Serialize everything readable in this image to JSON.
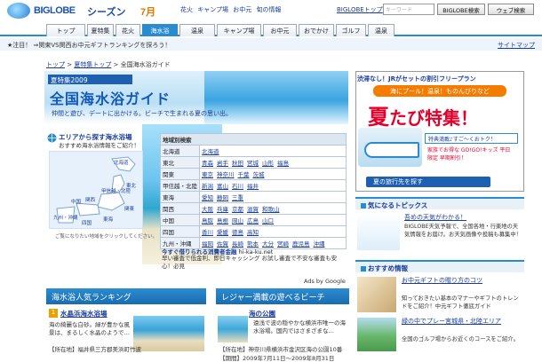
{
  "header": {
    "logo": "BIGLOBE",
    "season": "シーズン",
    "month": "7月",
    "links": [
      "花火",
      "キャンプ場",
      "お中元",
      "旬の情報"
    ],
    "biglobe_top": "BIGLOBEトップ",
    "search_placeholder": "キーワード",
    "search_button": "BIGLOBE検索",
    "web_search_button": "ウェブ検索"
  },
  "tabs": [
    "トップ",
    "夏特集",
    "花火",
    "海水浴",
    "温泉",
    "キャンプ場",
    "お中元",
    "おでかけ",
    "ゴルフ",
    "温泉"
  ],
  "news": {
    "text": "★注目！ ⇒関東VS関西お中元ギフトランキングを探ろう！",
    "sitemap": "サイトマップ"
  },
  "breadcrumb": [
    "トップ",
    "夏特集トップ",
    "全国海水浴ガイド"
  ],
  "hero": {
    "label": "夏特集2009",
    "title": "全国海水浴ガイド",
    "subtitle": "仲間と遊び、デートに出かける。ビーチで生まれる夏の思い出。"
  },
  "area": {
    "title": "エリアから探す海水浴場",
    "sub": "おすすめ海水浴情報をご紹介！",
    "regions": [
      "北海道",
      "東北",
      "関東",
      "甲信越・北陸",
      "東海",
      "関西",
      "中国",
      "四国",
      "九州・沖縄"
    ],
    "note": "ご覧になりたい地域をクリックしてください。"
  },
  "region_table": {
    "header": "地域別検索",
    "rows": [
      {
        "region": "北海道",
        "prefs": [
          "北海道"
        ]
      },
      {
        "region": "東北",
        "prefs": [
          "青森",
          "岩手",
          "秋田",
          "宮城",
          "山形",
          "福島"
        ]
      },
      {
        "region": "関東",
        "prefs": [
          "東京",
          "神奈川",
          "千葉",
          "茨城"
        ]
      },
      {
        "region": "甲信越・北陸",
        "prefs": [
          "新潟",
          "富山",
          "石川",
          "福井"
        ]
      },
      {
        "region": "東海",
        "prefs": [
          "愛知",
          "静岡",
          "三重"
        ]
      },
      {
        "region": "関西",
        "prefs": [
          "大阪",
          "兵庫",
          "京都",
          "滋賀",
          "和歌山"
        ]
      },
      {
        "region": "中国",
        "prefs": [
          "鳥取",
          "島根",
          "岡山",
          "広島",
          "山口"
        ]
      },
      {
        "region": "四国",
        "prefs": [
          "香川",
          "愛媛",
          "徳島",
          "高知"
        ]
      },
      {
        "region": "九州・沖縄",
        "prefs": [
          "福岡",
          "佐賀",
          "長崎",
          "熊本",
          "大分",
          "宮崎",
          "鹿児島",
          "沖縄"
        ]
      }
    ]
  },
  "ad": {
    "title": "今すぐ借りられる消費者金融",
    "url": "hi-ka-ku.net",
    "desc": "早い審査で低金利、即日キャッシング お試し審査で不安な審査も安心！必見",
    "ads_by": "Ads by Google"
  },
  "ranking": {
    "header": "海水浴人気ランキング",
    "num": "1",
    "name": "水晶浜海水浴場",
    "desc": "海の綺麗な白砂。緑が豊かな風景は、まるしく水晶のようで…",
    "loc": "【所在地】福井県三方郡美浜町竹波"
  },
  "leisure": {
    "header": "レジャー満載の遊べるビーチ",
    "name": "海の公園",
    "desc": "遠浅で波の穏やかな横浜市唯一の海水浴場。国内ではさまざまな…",
    "loc": "【所在地】神奈川県横浜市金沢区海の公園10番 【期間】2009年7月11日〜2009年8月31日"
  },
  "jr": {
    "top": "渋滞なし！JRがセットの割引フリープラン",
    "pill": "海にプール！温泉！ものんびりなど",
    "big": "夏",
    "big_rest": "たび特集！",
    "promo1": "特典満載♪すご〜くおトク！",
    "promo2": "家族でお得な GO!GO!キッズ 平日限定 早期割引！",
    "button": "夏の旅行先を探す"
  },
  "topics": {
    "header": "気になるトピックス",
    "link": "吾めの天気がわかる！",
    "desc": "BIGLOBE天気予報で、全国各地・行楽地の天気情報をお届け。お天気画像や投稿も募集中！"
  },
  "recommend": {
    "header": "おすすめ情報",
    "link1": "お中元ギフトの贈り方のコツ",
    "desc1": "知っておきたい基本のマナーやギフトのトレンドをご紹介！中元ギフト徹底ガイド",
    "link2": "緑の中でプレー宮城県・北陸エリア",
    "desc2": "全国のゴルフ場からお近くのコースをご紹介。"
  }
}
